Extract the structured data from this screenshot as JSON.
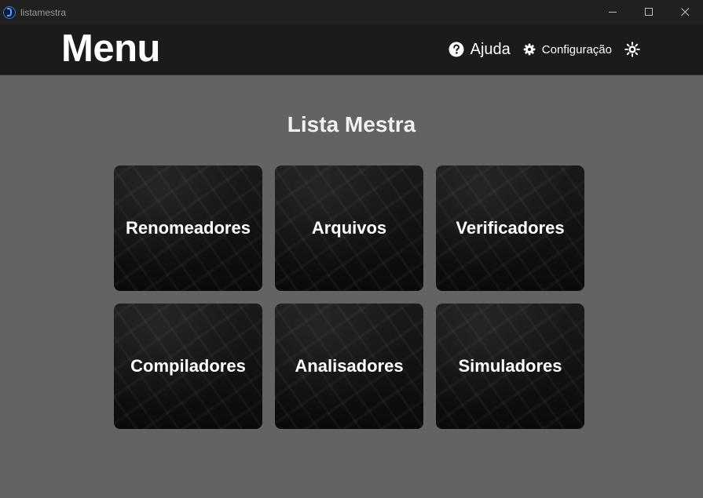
{
  "window": {
    "title": "listamestra",
    "minimize_label": "—",
    "maximize_label": "☐",
    "close_label": "✕"
  },
  "header": {
    "title": "Menu",
    "help_label": "Ajuda",
    "settings_label": "Configuração"
  },
  "main": {
    "heading": "Lista Mestra",
    "cards": [
      {
        "label": "Renomeadores"
      },
      {
        "label": "Arquivos"
      },
      {
        "label": "Verificadores"
      },
      {
        "label": "Compiladores"
      },
      {
        "label": "Analisadores"
      },
      {
        "label": "Simuladores"
      }
    ]
  },
  "icons": {
    "app": "app-logo-icon",
    "help": "question-circle-icon",
    "settings": "gear-icon",
    "theme": "sun-icon"
  },
  "colors": {
    "background": "#636363",
    "header": "#1b1b1b",
    "titlebar": "#202020",
    "card": "#111111",
    "text": "#ffffff"
  }
}
